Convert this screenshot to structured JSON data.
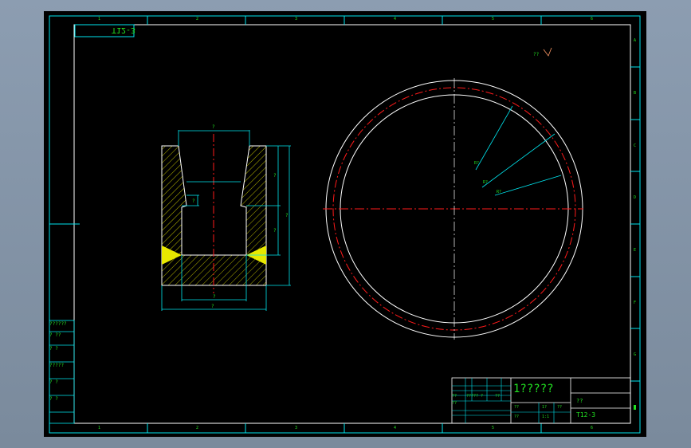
{
  "drawing": {
    "mirrored_code": "T12-3",
    "title": "1?????",
    "material": "??",
    "code": "T12-3",
    "roughness_note": "??",
    "top_zones": [
      "1",
      "2",
      "3",
      "4",
      "5",
      "6"
    ],
    "side_zones": [
      "A",
      "B",
      "C",
      "D",
      "E",
      "F",
      "G",
      "H"
    ],
    "left_block": [
      "??????",
      "?  ??",
      "?  ?",
      "?????",
      "? ?",
      "?  ?"
    ],
    "title_block_cells": [
      "??",
      "?????",
      "?",
      "??",
      "??",
      "??",
      "1?",
      "??",
      "??",
      "1:1"
    ],
    "dimensions": {
      "top_width": "?",
      "overall_width": "?",
      "bottom_bore": "?",
      "height": "?",
      "upper": "?",
      "lower": "?",
      "small": "?"
    },
    "radius_labels": [
      "R?",
      "R?",
      "R?"
    ]
  },
  "colors": {
    "frame": "#00e5ee",
    "outline": "#ffffff",
    "center": "#ff1a1a",
    "text": "#22e022",
    "hatch": "#e8e800"
  }
}
